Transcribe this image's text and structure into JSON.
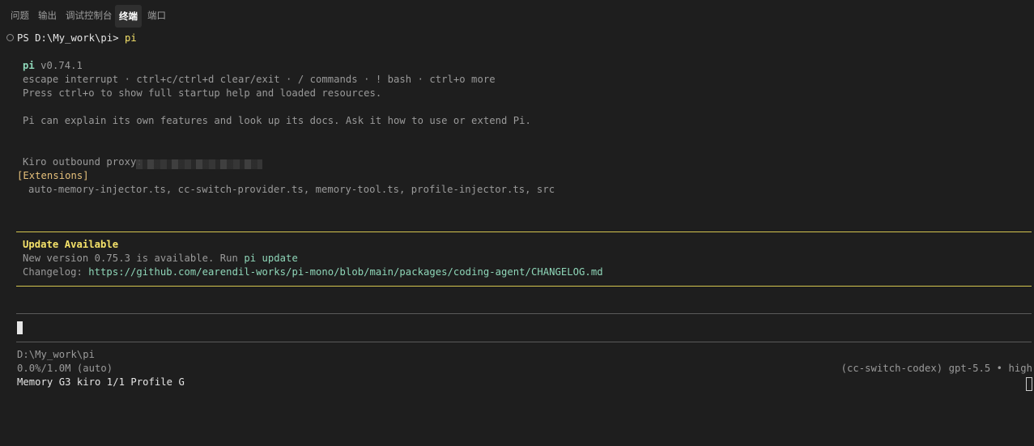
{
  "panel_tabs": [
    {
      "label": "问题"
    },
    {
      "label": "输出"
    },
    {
      "label": "调试控制台"
    },
    {
      "label": "终端"
    },
    {
      "label": "端口"
    }
  ],
  "prompt": {
    "ps": "PS D:\\My_work\\pi> ",
    "command": "pi"
  },
  "banner": {
    "app_name": "pi",
    "version": " v0.74.1",
    "keys_line": "escape interrupt · ctrl+c/ctrl+d clear/exit · / commands · ! bash · ctrl+o more",
    "help_line": "Press ctrl+o to show full startup help and loaded resources.",
    "explain_line": "Pi can explain its own features and look up its docs. Ask it how to use or extend Pi."
  },
  "proxy": {
    "label": "Kiro outbound proxy:"
  },
  "extensions": {
    "header": "[Extensions]",
    "list": "auto-memory-injector.ts, cc-switch-provider.ts, memory-tool.ts, profile-injector.ts, src"
  },
  "update": {
    "title": "Update Available",
    "message_prefix": "New version 0.75.3 is available. Run ",
    "command": "pi update",
    "changelog_label": "Changelog: ",
    "changelog_url": "https://github.com/earendil-works/pi-mono/blob/main/packages/coding-agent/CHANGELOG.md"
  },
  "footer": {
    "cwd": "D:\\My_work\\pi",
    "context_usage": "0.0%/1.0M (auto)",
    "model": "(cc-switch-codex) gpt-5.5 • high",
    "status_line": "Memory G3 kiro 1/1 Profile G"
  },
  "colors": {
    "background": "#1e1e1e",
    "accent_yellow": "#f6e36a",
    "accent_green": "#8fd7b9"
  }
}
